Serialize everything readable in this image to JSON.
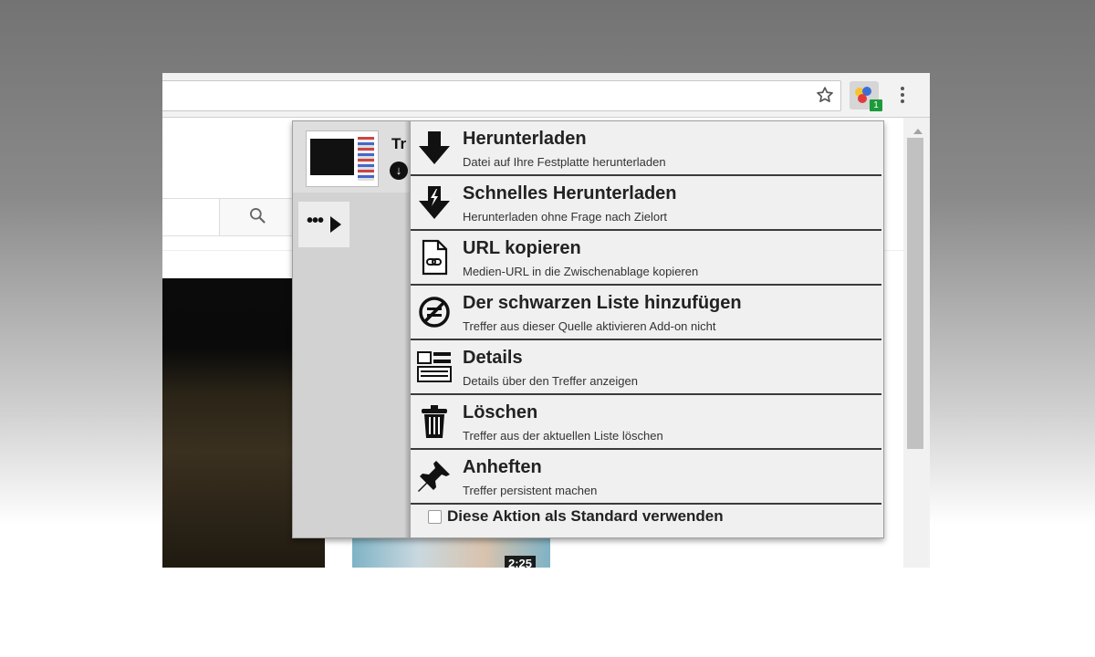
{
  "browser": {
    "toolbar": {
      "extension_badge": "1"
    },
    "page": {
      "video_duration": "2:25"
    }
  },
  "popup": {
    "left_pane": {
      "hit_title_truncated": "Tr"
    },
    "actions": [
      {
        "icon": "download-arrow-icon",
        "title": "Herunterladen",
        "desc": "Datei auf Ihre Festplatte herunterladen"
      },
      {
        "icon": "quick-download-icon",
        "title": "Schnelles Herunterladen",
        "desc": "Herunterladen ohne Frage nach Zielort"
      },
      {
        "icon": "copy-link-file-icon",
        "title": "URL kopieren",
        "desc": "Medien-URL in die Zwischenablage kopieren"
      },
      {
        "icon": "blacklist-icon",
        "title": "Der schwarzen Liste hinzufügen",
        "desc": "Treffer aus dieser Quelle aktivieren Add-on nicht"
      },
      {
        "icon": "details-icon",
        "title": "Details",
        "desc": "Details über den Treffer anzeigen"
      },
      {
        "icon": "trash-icon",
        "title": "Löschen",
        "desc": "Treffer aus der aktuellen Liste löschen"
      },
      {
        "icon": "pin-icon",
        "title": "Anheften",
        "desc": "Treffer persistent machen"
      }
    ],
    "default_checkbox_label": "Diese Aktion als Standard verwenden"
  }
}
